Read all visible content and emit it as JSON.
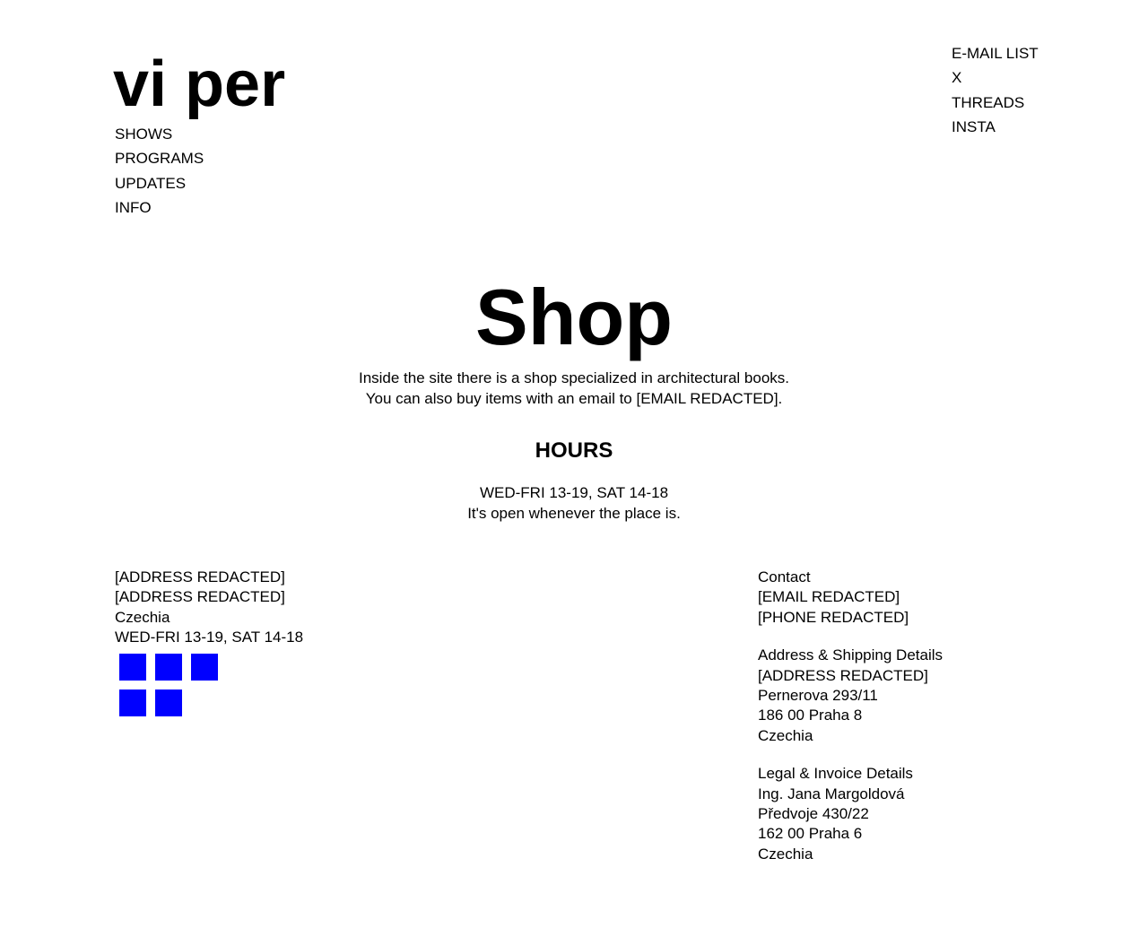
{
  "header": {
    "logo": "vi per",
    "nav": [
      "SHOWS",
      "PROGRAMS",
      "UPDATES",
      "INFO"
    ],
    "social": [
      "E-MAIL LIST",
      "X",
      "THREADS",
      "INSTA"
    ]
  },
  "shop": {
    "title": "Shop",
    "description": [
      "Inside the site there is a shop specialized in architectural books.",
      "You can also buy items with an email to [EMAIL REDACTED]."
    ]
  },
  "hours": {
    "heading": "HOURS",
    "schedule": "WED-FRI 13-19, SAT 14-18",
    "note": "It's open whenever the place is."
  },
  "footer": {
    "left": {
      "lines": [
        "[ADDRESS REDACTED]",
        "[ADDRESS REDACTED]",
        "Czechia",
        "WED-FRI 13-19, SAT 14-18"
      ],
      "icon_color": "#0000ff",
      "icon_count": 5
    },
    "contact": {
      "heading": "Contact",
      "lines": [
        "[EMAIL REDACTED]",
        "[PHONE REDACTED]"
      ]
    },
    "shipping": {
      "heading": "Address & Shipping Details",
      "lines": [
        "[ADDRESS REDACTED]",
        "Pernerova 293/11",
        "186 00 Praha 8",
        "Czechia"
      ]
    },
    "legal": {
      "heading": "Legal & Invoice Details",
      "lines": [
        "Ing. Jana Margoldová",
        "Předvoje 430/22",
        "162 00 Praha 6",
        "Czechia"
      ]
    }
  }
}
